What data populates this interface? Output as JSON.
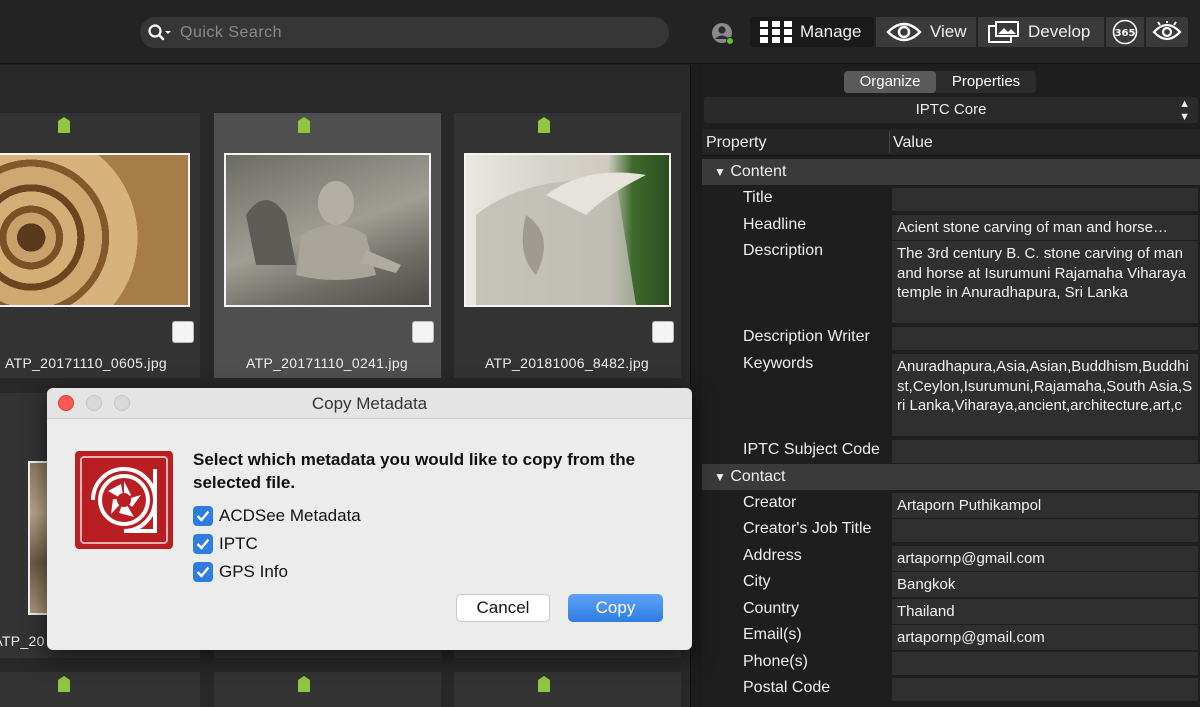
{
  "topbar": {
    "search_placeholder": "Quick Search",
    "modes": {
      "manage": "Manage",
      "view": "View",
      "develop": "Develop",
      "online": "365"
    }
  },
  "browser": {
    "files": [
      "ATP_20171110_0605.jpg",
      "ATP_20171110_0241.jpg",
      "ATP_20181006_8482.jpg",
      "ATP_20"
    ]
  },
  "dialog": {
    "title": "Copy Metadata",
    "message": "Select which metadata you would like to copy from the selected file.",
    "options": [
      {
        "label": "ACDSee Metadata",
        "checked": true
      },
      {
        "label": "IPTC",
        "checked": true
      },
      {
        "label": "GPS Info",
        "checked": true
      }
    ],
    "cancel_label": "Cancel",
    "copy_label": "Copy"
  },
  "panel": {
    "tabs": [
      "Organize",
      "Properties"
    ],
    "active_tab": "Organize",
    "selector": "IPTC Core",
    "columns": [
      "Property",
      "Value"
    ],
    "sections": {
      "content": "Content",
      "contact": "Contact"
    },
    "rows": [
      {
        "property": "Title",
        "value": ""
      },
      {
        "property": "Headline",
        "value": "Acient stone carving of man and horse…"
      },
      {
        "property": "Description",
        "value": "The 3rd century B. C. stone carving of man and horse at Isurumuni Rajamaha Viharaya temple in Anuradhapura, Sri Lanka"
      },
      {
        "property": "Description Writer",
        "value": ""
      },
      {
        "property": "Keywords",
        "value": "Anuradhapura,Asia,Asian,Buddhism,Buddhist,Ceylon,Isurumuni,Rajamaha,South Asia,Sri Lanka,Viharaya,ancient,architecture,art,c"
      },
      {
        "property": "IPTC Subject Code",
        "value": ""
      },
      {
        "property": "Creator",
        "value": "Artaporn Puthikampol"
      },
      {
        "property": "Creator's Job Title",
        "value": ""
      },
      {
        "property": "Address",
        "value": "artapornp@gmail.com"
      },
      {
        "property": "City",
        "value": "Bangkok"
      },
      {
        "property": "Country",
        "value": "Thailand"
      },
      {
        "property": "Email(s)",
        "value": "artapornp@gmail.com"
      },
      {
        "property": "Phone(s)",
        "value": ""
      },
      {
        "property": "Postal Code",
        "value": ""
      }
    ]
  },
  "colors": {
    "accent": "#2f7de1",
    "tag": "#8fc63f",
    "logo": "#b81e22"
  }
}
